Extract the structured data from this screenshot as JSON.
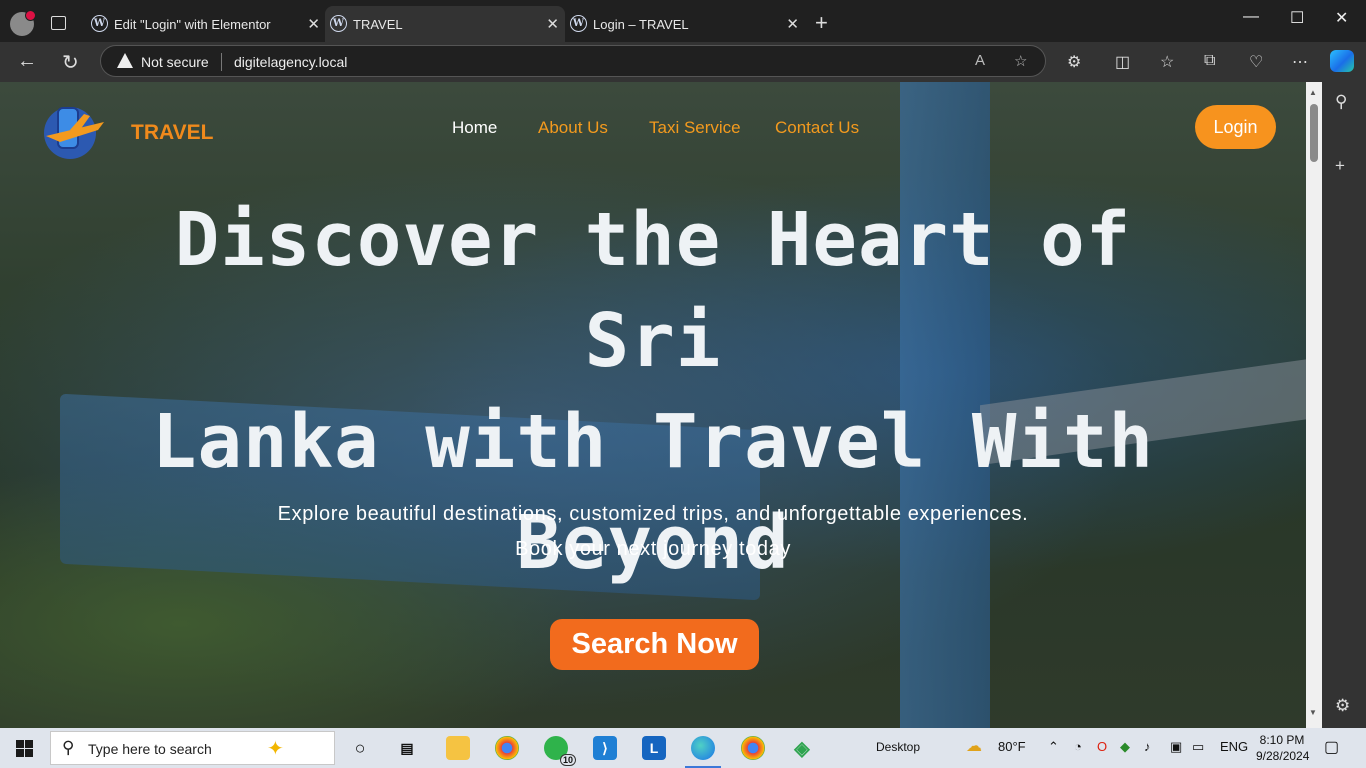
{
  "browser": {
    "tabs": [
      {
        "title": "Edit \"Login\" with Elementor",
        "active": false
      },
      {
        "title": "TRAVEL",
        "active": true
      },
      {
        "title": "Login – TRAVEL",
        "active": false
      }
    ],
    "security_label": "Not secure",
    "url": "digitelagency.local"
  },
  "site": {
    "brand": "TRAVEL",
    "nav": [
      "Home",
      "About Us",
      "Taxi Service",
      "Contact Us"
    ],
    "login_label": "Login",
    "hero_lines": [
      "Discover the Heart of Sri",
      "Lanka with Travel With",
      "Beyond"
    ],
    "subtitle_1": "Explore beautiful destinations, customized trips, and unforgettable experiences.",
    "subtitle_2": "Book your next journey today",
    "search_label": "Search Now",
    "colors": {
      "accent": "#f7931e",
      "search_button": "#f26b1d"
    }
  },
  "taskbar": {
    "search_placeholder": "Type here to search",
    "whatsapp_badge": "10",
    "desktop_label": "Desktop",
    "weather": "80°F",
    "language": "ENG",
    "time": "8:10 PM",
    "date": "9/28/2024"
  }
}
